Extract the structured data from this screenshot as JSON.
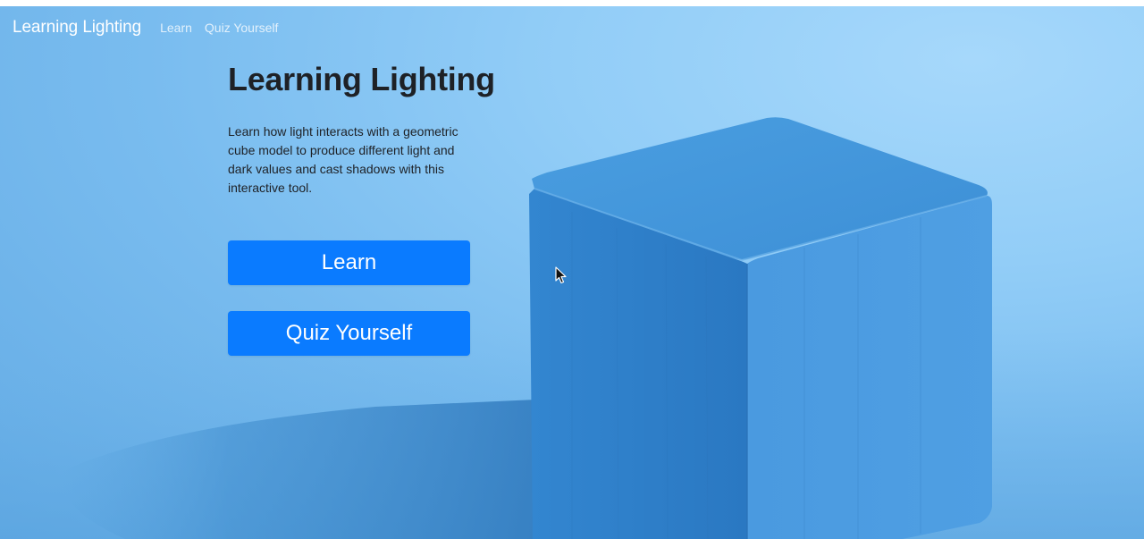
{
  "nav": {
    "brand": "Learning Lighting",
    "links": [
      "Learn",
      "Quiz Yourself"
    ]
  },
  "hero": {
    "title": "Learning Lighting",
    "description": "Learn how light interacts with a geometric cube model to produce different light and dark values and cast shadows with this interactive tool.",
    "buttons": {
      "learn": "Learn",
      "quiz": "Quiz Yourself"
    }
  },
  "colors": {
    "accent": "#0a7bff",
    "background": "#8ec9f5",
    "cube": "#2f7cc6"
  },
  "icons": {
    "cursor": "arrow-cursor-icon"
  }
}
